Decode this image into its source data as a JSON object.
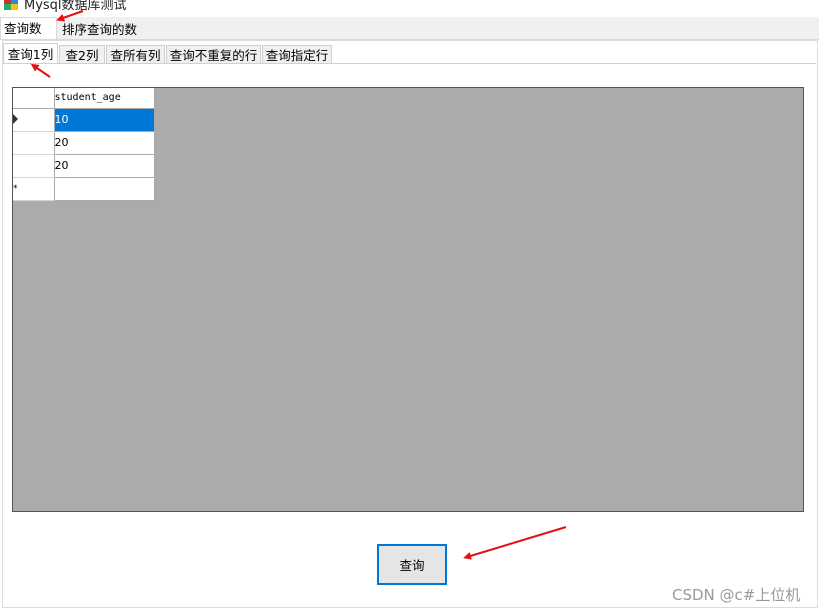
{
  "window": {
    "title": "Mysql数据库测试"
  },
  "outer_tabs": [
    {
      "label": "查询数据",
      "active": true
    },
    {
      "label": "排序查询的数据",
      "active": false
    }
  ],
  "inner_tabs": [
    {
      "label": "查询1列",
      "active": true
    },
    {
      "label": "查2列",
      "active": false
    },
    {
      "label": "查所有列",
      "active": false
    },
    {
      "label": "查询不重复的行",
      "active": false
    },
    {
      "label": "查询指定行",
      "active": false
    }
  ],
  "grid": {
    "column_header": "student_age",
    "rows": [
      {
        "marker": "current-row",
        "value": "10",
        "selected": true
      },
      {
        "marker": "",
        "value": "20",
        "selected": false
      },
      {
        "marker": "",
        "value": "20",
        "selected": false
      },
      {
        "marker": "new-row",
        "value": "",
        "selected": false
      }
    ],
    "new_row_glyph": "*",
    "background_color": "#ababab",
    "selection_color": "#0078d7"
  },
  "query_button": {
    "label": "查询"
  },
  "annotation_color": "#e81010",
  "watermark": "CSDN @c#上位机"
}
